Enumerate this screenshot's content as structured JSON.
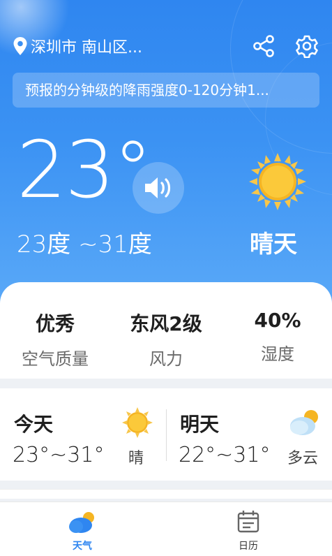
{
  "header": {
    "location": "深圳市 南山区...",
    "notice": "预报的分钟级的降雨强度0-120分钟1..."
  },
  "current": {
    "temperature": "23°",
    "range": "23度 ~31度",
    "condition": "晴天"
  },
  "stats": [
    {
      "value": "优秀",
      "label": "空气质量"
    },
    {
      "value": "东风2级",
      "label": "风力"
    },
    {
      "value": "40%",
      "label": "湿度"
    }
  ],
  "forecast": {
    "today": {
      "title": "今天",
      "temp": "23°~31°",
      "cond": "晴",
      "icon": "sun-icon"
    },
    "tomorrow": {
      "title": "明天",
      "temp": "22°~31°",
      "cond": "多云",
      "icon": "cloudy-icon"
    }
  },
  "tabs": [
    {
      "label": "天气",
      "icon": "weather-cloud-icon",
      "active": true
    },
    {
      "label": "日历",
      "icon": "calendar-icon",
      "active": false
    }
  ],
  "colors": {
    "accent": "#2f86f0",
    "sun": "#f5b523"
  }
}
